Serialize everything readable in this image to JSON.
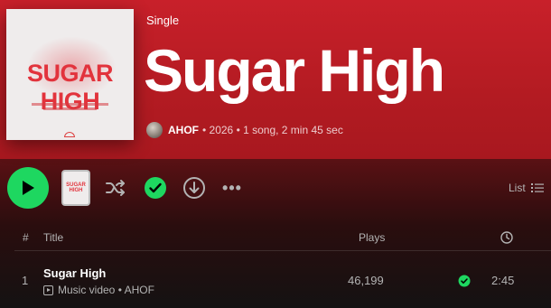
{
  "header": {
    "type_label": "Single",
    "title": "Sugar High",
    "artist": "AHOF",
    "meta_rest": "• 2026 • 1 song, 2 min 45 sec"
  },
  "cover": {
    "art_text": "SUGAR HIGH"
  },
  "actions": {
    "play_icon": "play-icon",
    "shuffle_icon": "shuffle-icon",
    "saved_icon": "check-circle-icon",
    "download_icon": "download-icon",
    "more_label": "•••",
    "view_label": "List"
  },
  "table": {
    "headers": {
      "number": "#",
      "title": "Title",
      "plays": "Plays"
    },
    "rows": [
      {
        "number": "1",
        "title": "Sugar High",
        "subtitle": "Music video • AHOF",
        "plays": "46,199",
        "duration": "2:45"
      }
    ]
  },
  "colors": {
    "accent": "#1ed760",
    "hero": "#c8202a",
    "cover_text": "#e2333c"
  }
}
